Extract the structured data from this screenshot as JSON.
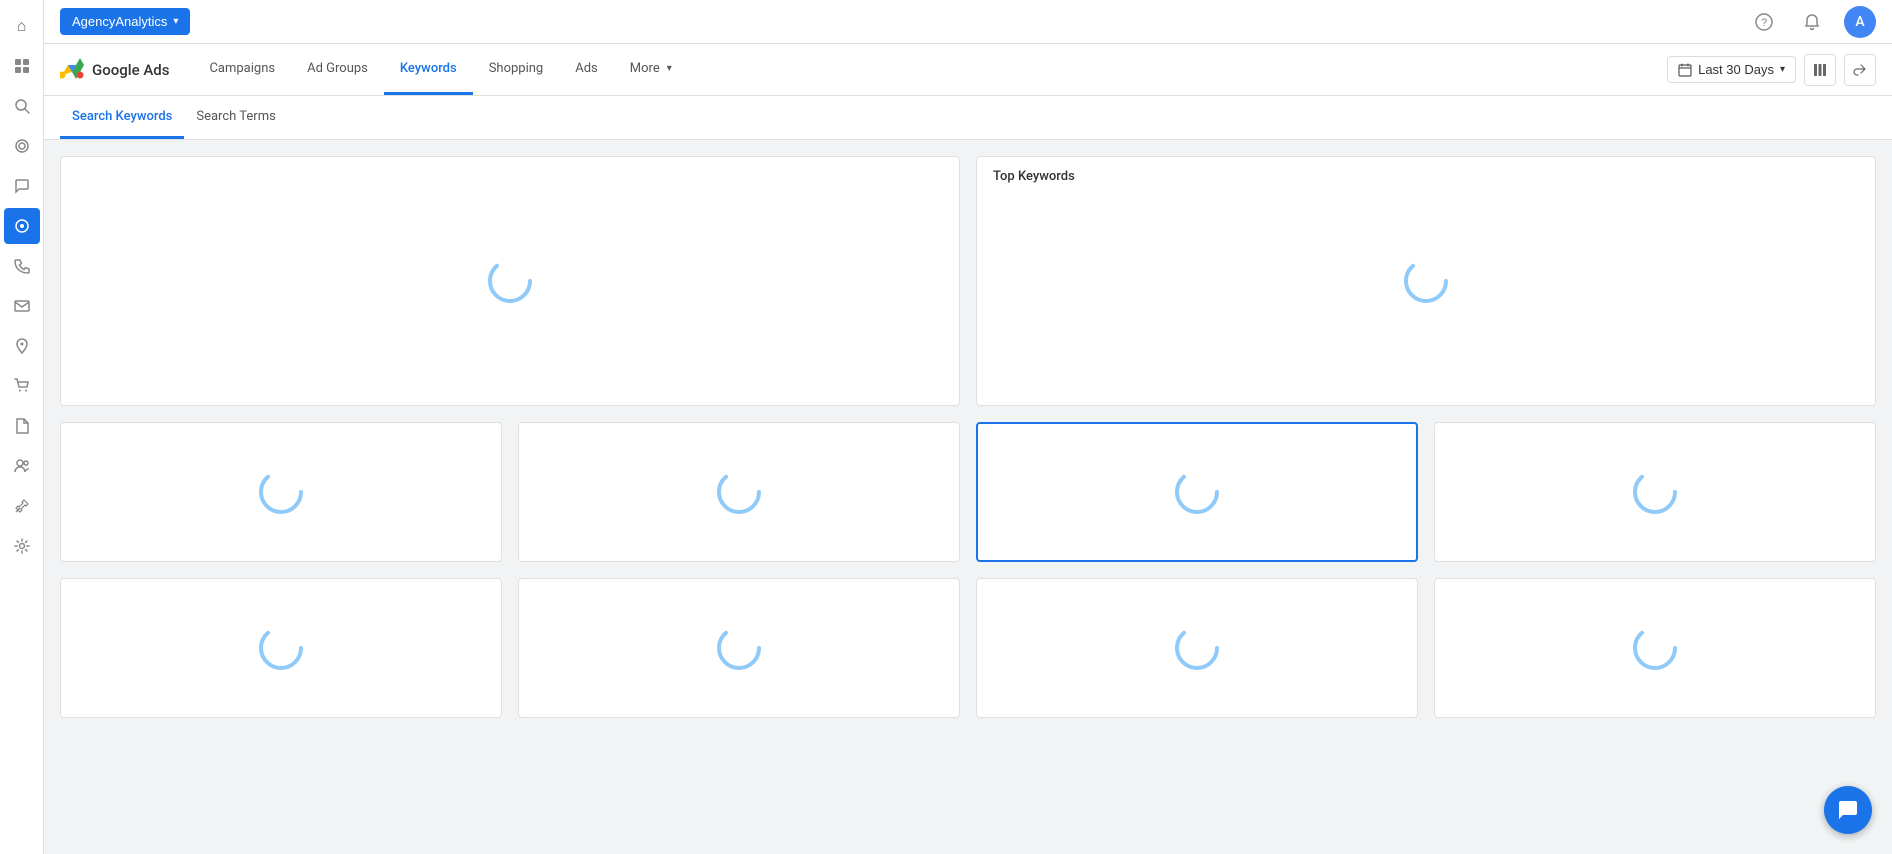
{
  "far_sidebar": {
    "icons": [
      {
        "name": "home-icon",
        "symbol": "⌂"
      },
      {
        "name": "grid-icon",
        "symbol": "⊞"
      },
      {
        "name": "search-icon",
        "symbol": "🔍"
      },
      {
        "name": "chart-icon",
        "symbol": "◉"
      },
      {
        "name": "chat-icon",
        "symbol": "💬"
      },
      {
        "name": "target-icon",
        "symbol": "◎",
        "active": true
      },
      {
        "name": "phone-icon",
        "symbol": "📞"
      },
      {
        "name": "email-icon",
        "symbol": "✉"
      },
      {
        "name": "location-icon",
        "symbol": "📍"
      },
      {
        "name": "cart-icon",
        "symbol": "🛒"
      },
      {
        "name": "doc-icon",
        "symbol": "📄"
      },
      {
        "name": "users-icon",
        "symbol": "👥"
      },
      {
        "name": "pin-icon",
        "symbol": "📌"
      },
      {
        "name": "settings-icon",
        "symbol": "⚙"
      }
    ]
  },
  "header": {
    "agency_label": "AgencyAnalytics",
    "help_icon": "?",
    "bell_icon": "🔔",
    "avatar_letter": "A"
  },
  "ads_nav": {
    "logo_text": "Google Ads",
    "tabs": [
      {
        "label": "Campaigns",
        "active": false
      },
      {
        "label": "Ad Groups",
        "active": false
      },
      {
        "label": "Keywords",
        "active": true
      },
      {
        "label": "Shopping",
        "active": false
      },
      {
        "label": "Ads",
        "active": false
      },
      {
        "label": "More",
        "active": false,
        "has_chevron": true
      }
    ],
    "date_picker": {
      "icon": "📅",
      "label": "Last 30 Days",
      "chevron": "▾"
    },
    "columns_icon": "⊞",
    "share_icon": "↗"
  },
  "sub_tabs": [
    {
      "label": "Search Keywords",
      "active": true
    },
    {
      "label": "Search Terms",
      "active": false
    }
  ],
  "cards": {
    "top_left": {
      "title": ""
    },
    "top_right": {
      "title": "Top Keywords"
    },
    "bottom_row1": [
      {
        "title": ""
      },
      {
        "title": ""
      },
      {
        "title": "",
        "highlighted": true
      },
      {
        "title": ""
      }
    ],
    "bottom_row2": [
      {
        "title": ""
      },
      {
        "title": ""
      },
      {
        "title": ""
      },
      {
        "title": ""
      }
    ]
  },
  "chat_icon": "💬"
}
